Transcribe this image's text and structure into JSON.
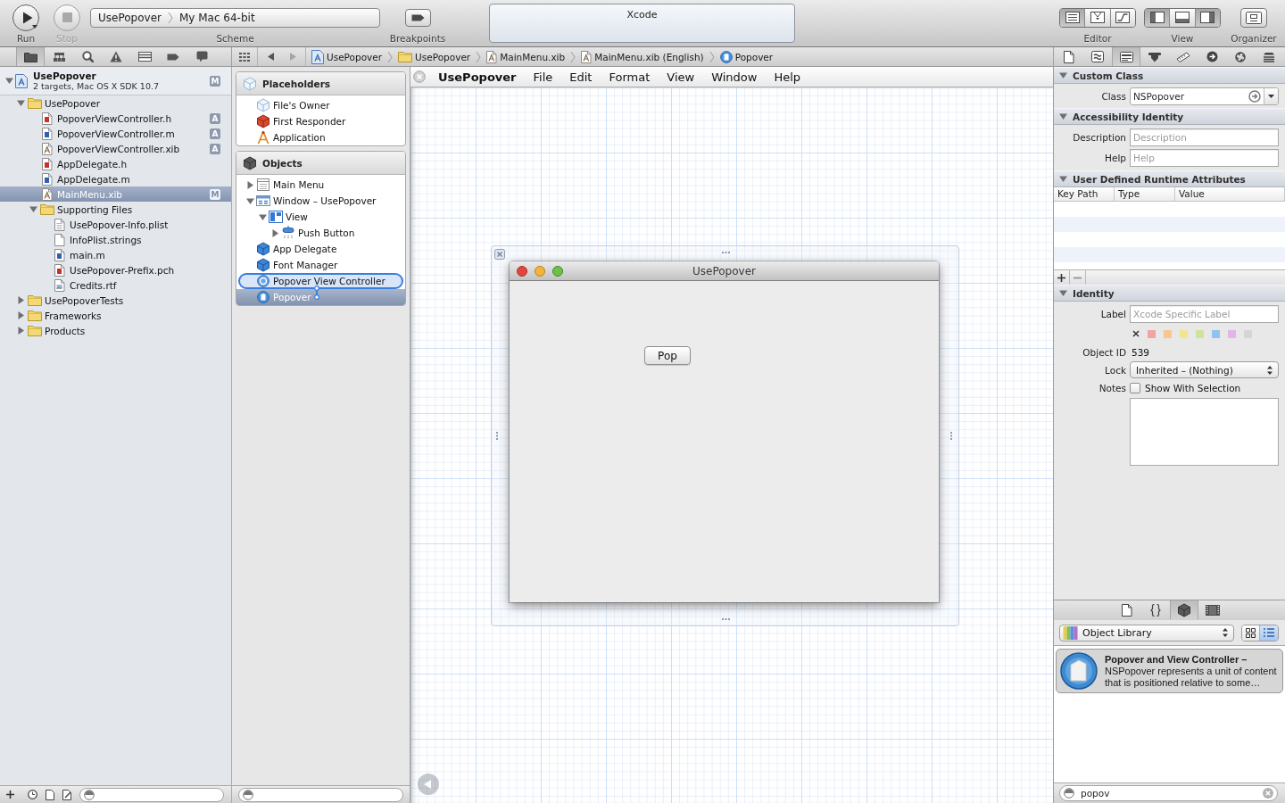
{
  "toolbar": {
    "run": {
      "label": "Run"
    },
    "stop": {
      "label": "Stop",
      "disabled": true
    },
    "scheme": {
      "label": "Scheme",
      "target": "UsePopover",
      "destination": "My Mac 64-bit"
    },
    "breakpoints": {
      "label": "Breakpoints"
    },
    "activity": {
      "title": "Xcode"
    },
    "editor": {
      "label": "Editor",
      "segments": [
        {
          "kind": "standard",
          "selected": true
        },
        {
          "kind": "assistant",
          "selected": false
        },
        {
          "kind": "version",
          "selected": false
        }
      ]
    },
    "view": {
      "label": "View",
      "segments": [
        {
          "kind": "navigator",
          "selected": true
        },
        {
          "kind": "debug",
          "selected": false
        },
        {
          "kind": "utilities",
          "selected": true
        }
      ]
    },
    "organizer": {
      "label": "Organizer"
    }
  },
  "navigator_tabs": [
    {
      "kind": "project",
      "selected": true
    },
    {
      "kind": "symbol",
      "selected": false
    },
    {
      "kind": "search",
      "selected": false
    },
    {
      "kind": "issue",
      "selected": false
    },
    {
      "kind": "debug",
      "selected": false
    },
    {
      "kind": "breakpoint",
      "selected": false
    },
    {
      "kind": "log",
      "selected": false
    }
  ],
  "history_buttons": [
    {
      "kind": "back",
      "disabled": false
    },
    {
      "kind": "forward",
      "disabled": true
    }
  ],
  "jump_bar": [
    {
      "kind": "project",
      "label": "UsePopover"
    },
    {
      "kind": "folder",
      "label": "UsePopover"
    },
    {
      "kind": "xib",
      "label": "MainMenu.xib"
    },
    {
      "kind": "xib",
      "label": "MainMenu.xib (English)"
    },
    {
      "kind": "popover",
      "label": "Popover"
    }
  ],
  "inspector_tabs": [
    {
      "kind": "file",
      "selected": false
    },
    {
      "kind": "help",
      "selected": false
    },
    {
      "kind": "identity",
      "selected": true
    },
    {
      "kind": "attributes",
      "selected": false
    },
    {
      "kind": "size",
      "selected": false
    },
    {
      "kind": "connections",
      "selected": false
    },
    {
      "kind": "bindings",
      "selected": false
    },
    {
      "kind": "effects",
      "selected": false
    }
  ],
  "project_navigator": {
    "project": {
      "name": "UsePopover",
      "subtitle": "2 targets, Mac OS X SDK 10.7",
      "badge": "M",
      "expanded": true,
      "selected": false
    },
    "items": [
      {
        "name": "UsePopover",
        "kind": "folder",
        "expanded": true,
        "selected": false,
        "children": [
          {
            "name": "PopoverViewController.h",
            "kind": "header",
            "badge": "A",
            "selected": false
          },
          {
            "name": "PopoverViewController.m",
            "kind": "source",
            "badge": "A",
            "selected": false
          },
          {
            "name": "PopoverViewController.xib",
            "kind": "xib",
            "badge": "A",
            "selected": false
          },
          {
            "name": "AppDelegate.h",
            "kind": "header",
            "selected": false
          },
          {
            "name": "AppDelegate.m",
            "kind": "source",
            "selected": false
          },
          {
            "name": "MainMenu.xib",
            "kind": "xib",
            "badge": "M",
            "selected": true
          },
          {
            "name": "Supporting Files",
            "kind": "folder",
            "expanded": true,
            "selected": false,
            "children": [
              {
                "name": "UsePopover-Info.plist",
                "kind": "plist",
                "selected": false
              },
              {
                "name": "InfoPlist.strings",
                "kind": "strings",
                "selected": false
              },
              {
                "name": "main.m",
                "kind": "source",
                "selected": false
              },
              {
                "name": "UsePopover-Prefix.pch",
                "kind": "header",
                "selected": false
              },
              {
                "name": "Credits.rtf",
                "kind": "rtf",
                "selected": false
              }
            ]
          }
        ]
      },
      {
        "name": "UsePopoverTests",
        "kind": "folder",
        "expanded": false,
        "selected": false
      },
      {
        "name": "Frameworks",
        "kind": "folder",
        "expanded": false,
        "selected": false
      },
      {
        "name": "Products",
        "kind": "folder",
        "expanded": false,
        "selected": false
      }
    ]
  },
  "document_outline": {
    "sections": [
      {
        "title": "Placeholders",
        "kind": "placeholders",
        "items": [
          {
            "label": "File's Owner",
            "kind": "files-owner",
            "selected": false,
            "highlighted": false
          },
          {
            "label": "First Responder",
            "kind": "first-responder",
            "selected": false,
            "highlighted": false
          },
          {
            "label": "Application",
            "kind": "application",
            "selected": false,
            "highlighted": false
          }
        ]
      },
      {
        "title": "Objects",
        "kind": "objects",
        "items": [
          {
            "label": "Main Menu",
            "kind": "menu",
            "expanded": false,
            "selected": false,
            "highlighted": false
          },
          {
            "label": "Window – UsePopover",
            "kind": "window",
            "expanded": true,
            "selected": false,
            "highlighted": false,
            "children": [
              {
                "label": "View",
                "kind": "view",
                "expanded": true,
                "selected": false,
                "highlighted": false,
                "children": [
                  {
                    "label": "Push Button",
                    "kind": "button",
                    "expanded": false,
                    "selected": false,
                    "highlighted": false
                  }
                ]
              }
            ]
          },
          {
            "label": "App Delegate",
            "kind": "object",
            "selected": false,
            "highlighted": false
          },
          {
            "label": "Font Manager",
            "kind": "object",
            "selected": false,
            "highlighted": false
          },
          {
            "label": "Popover View Controller",
            "kind": "view-controller",
            "selected": false,
            "highlighted": true
          },
          {
            "label": "Popover",
            "kind": "popover",
            "selected": true,
            "highlighted": false
          }
        ]
      }
    ]
  },
  "canvas": {
    "menu_bar": {
      "app_name": "UsePopover",
      "menus": [
        "File",
        "Edit",
        "Format",
        "View",
        "Window",
        "Help"
      ]
    },
    "window": {
      "title": "UsePopover",
      "button": "Pop"
    }
  },
  "inspector": {
    "custom_class": {
      "title": "Custom Class",
      "expanded": true,
      "class": {
        "label": "Class",
        "value": "NSPopover"
      }
    },
    "accessibility": {
      "title": "Accessibility Identity",
      "expanded": true,
      "description": {
        "label": "Description",
        "placeholder": "Description"
      },
      "help": {
        "label": "Help",
        "placeholder": "Help"
      }
    },
    "runtime_attributes": {
      "title": "User Defined Runtime Attributes",
      "expanded": true,
      "columns": [
        "Key Path",
        "Type",
        "Value"
      ]
    },
    "identity": {
      "title": "Identity",
      "expanded": true,
      "label": {
        "label": "Label",
        "placeholder": "Xcode Specific Label"
      },
      "label_colors": [
        {
          "kind": "none",
          "selected": false
        },
        {
          "kind": "color",
          "color": "#f4a3a3",
          "selected": false
        },
        {
          "kind": "color",
          "color": "#f8c690",
          "selected": false
        },
        {
          "kind": "color",
          "color": "#f3e58c",
          "selected": false
        },
        {
          "kind": "color",
          "color": "#cfe39a",
          "selected": false
        },
        {
          "kind": "color",
          "color": "#8ec3ef",
          "selected": false
        },
        {
          "kind": "color",
          "color": "#e0b6e6",
          "selected": false
        },
        {
          "kind": "color",
          "color": "#d5d5d5",
          "selected": false
        }
      ],
      "object_id": {
        "label": "Object ID",
        "value": "539"
      },
      "lock": {
        "label": "Lock",
        "value": "Inherited – (Nothing)"
      },
      "notes": {
        "label": "Notes",
        "show_with_selection": {
          "label": "Show With Selection",
          "checked": false
        }
      }
    }
  },
  "library": {
    "tabs": [
      {
        "kind": "file-template",
        "selected": false
      },
      {
        "kind": "snippet",
        "selected": false
      },
      {
        "kind": "object",
        "selected": true
      },
      {
        "kind": "media",
        "selected": false
      }
    ],
    "source": "Object Library",
    "view_modes": [
      {
        "kind": "grid",
        "selected": false
      },
      {
        "kind": "list",
        "selected": true
      }
    ],
    "items": [
      {
        "text": "**Popover and View Controller –** NSPopover represents a unit of content that is positioned relative to some…",
        "selected": true
      }
    ],
    "filter": {
      "value": "popov"
    }
  }
}
